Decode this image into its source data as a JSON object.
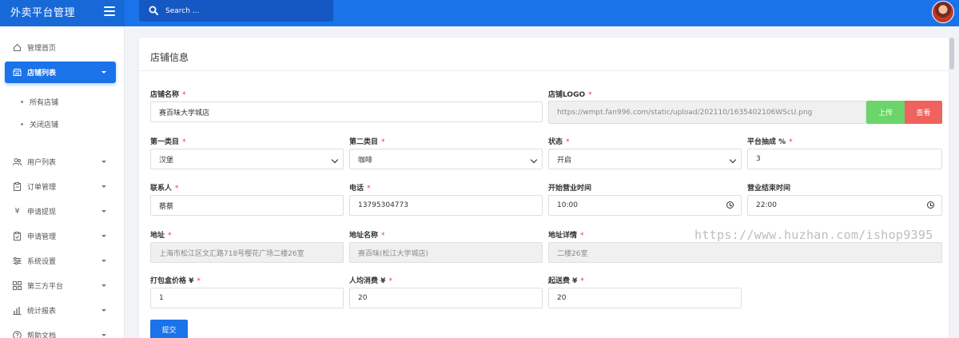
{
  "app": {
    "title": "外卖平台管理"
  },
  "search": {
    "placeholder": "Search ..."
  },
  "sidebar": {
    "items": [
      {
        "label": "管理首页",
        "icon": "home-icon"
      },
      {
        "label": "店铺列表",
        "icon": "store-icon",
        "active": true
      },
      {
        "label": "用户列表",
        "icon": "users-icon"
      },
      {
        "label": "订单管理",
        "icon": "clipboard-icon"
      },
      {
        "label": "申请提现",
        "icon": "yen-icon"
      },
      {
        "label": "申请管理",
        "icon": "clipboard-check-icon"
      },
      {
        "label": "系统设置",
        "icon": "sliders-icon"
      },
      {
        "label": "第三方平台",
        "icon": "grid-icon"
      },
      {
        "label": "统计报表",
        "icon": "bar-chart-icon"
      },
      {
        "label": "帮助文档",
        "icon": "help-icon"
      }
    ],
    "sub_items": [
      "所有店铺",
      "关闭店铺"
    ]
  },
  "page": {
    "title": "店铺信息"
  },
  "form": {
    "shop_name": {
      "label": "店铺名称",
      "value": "赛百味大学城店"
    },
    "logo": {
      "label": "店铺LOGO",
      "value": "https://wmpt.fan996.com/static/upload/202110/1635402106WScU.png",
      "upload_label": "上传",
      "view_label": "查看"
    },
    "category1": {
      "label": "第一类目",
      "value": "汉堡"
    },
    "category2": {
      "label": "第二类目",
      "value": "咖啡"
    },
    "status": {
      "label": "状态",
      "value": "开启"
    },
    "commission": {
      "label": "平台抽成 %",
      "value": "3"
    },
    "contact": {
      "label": "联系人",
      "value": "蔡蔡"
    },
    "phone": {
      "label": "电话",
      "value": "13795304773"
    },
    "open_time": {
      "label": "开始营业时间",
      "value": "10:00"
    },
    "close_time": {
      "label": "营业结束时间",
      "value": "22:00"
    },
    "address": {
      "label": "地址",
      "value": "上海市松江区文汇路718号樱花广场二楼26室"
    },
    "address_name": {
      "label": "地址名称",
      "value": "赛百味(松江大学城店)"
    },
    "address_detail": {
      "label": "地址详情",
      "value": "二楼26室"
    },
    "box_price": {
      "label": "打包盒价格 ¥",
      "value": "1"
    },
    "avg_spend": {
      "label": "人均消费 ¥",
      "value": "20"
    },
    "min_delivery": {
      "label": "起送费 ¥",
      "value": "20"
    },
    "required_mark": "*",
    "submit_label": "提交"
  },
  "watermark": "https://www.huzhan.com/ishop9395",
  "colors": {
    "primary": "#1a73e8",
    "upload": "#6bd56b",
    "view": "#f0625d",
    "required": "#e53935"
  }
}
